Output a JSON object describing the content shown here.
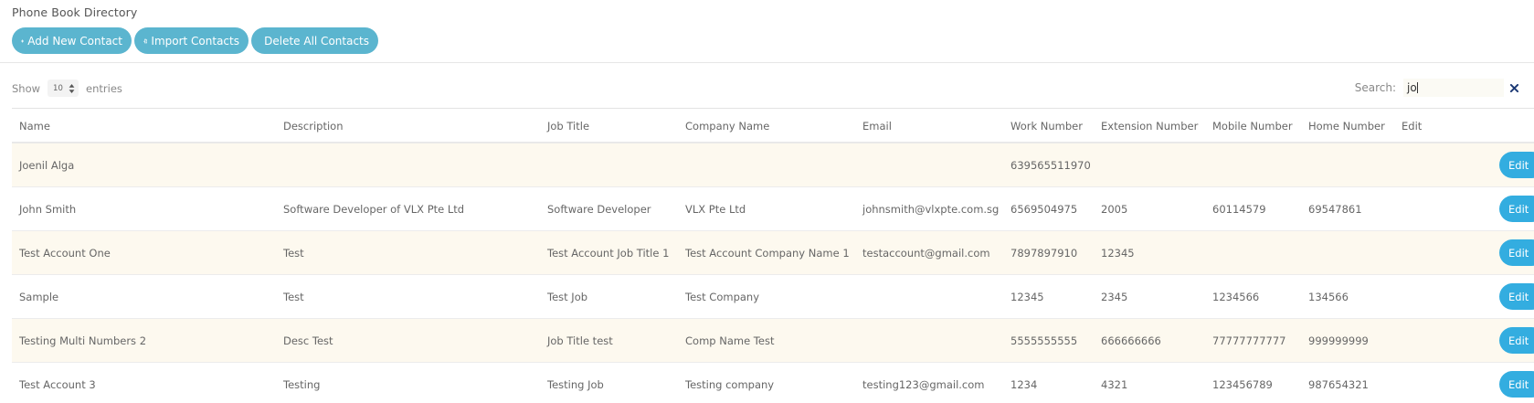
{
  "page": {
    "title": "Phone Book Directory"
  },
  "actions": [
    {
      "label": "Add New Contact",
      "icon": "plus-icon"
    },
    {
      "label": "Import Contacts",
      "icon": "file-import-icon"
    },
    {
      "label": "Delete All Contacts",
      "icon": "trash-icon"
    }
  ],
  "length_control": {
    "show_label": "Show",
    "value": "10",
    "entries_label": "entries"
  },
  "search": {
    "label": "Search:",
    "value": "jo"
  },
  "table": {
    "columns": [
      "Name",
      "Description",
      "Job Title",
      "Company Name",
      "Email",
      "Work Number",
      "Extension Number",
      "Mobile Number",
      "Home Number",
      "Edit"
    ],
    "edit_label": "Edit",
    "rows": [
      [
        "Joenil Alga",
        "",
        "",
        "",
        "",
        "639565511970",
        "",
        "",
        ""
      ],
      [
        "John Smith",
        "Software Developer of VLX Pte Ltd",
        "Software Developer",
        "VLX Pte Ltd",
        "johnsmith@vlxpte.com.sg",
        "6569504975",
        "2005",
        "60114579",
        "69547861"
      ],
      [
        "Test Account One",
        "Test",
        "Test Account Job Title 1",
        "Test Account Company Name 1",
        "testaccount@gmail.com",
        "7897897910",
        "12345",
        "",
        ""
      ],
      [
        "Sample",
        "Test",
        "Test Job",
        "Test Company",
        "",
        "12345",
        "2345",
        "1234566",
        "134566"
      ],
      [
        "Testing Multi Numbers 2",
        "Desc Test",
        "Job Title test",
        "Comp Name Test",
        "",
        "5555555555",
        "666666666",
        "77777777777",
        "999999999"
      ],
      [
        "Test Account 3",
        "Testing",
        "Testing Job",
        "Testing company",
        "testing123@gmail.com",
        "1234",
        "4321",
        "123456789",
        "987654321"
      ]
    ]
  },
  "colors": {
    "action_button": "#5bb5cf",
    "edit_button": "#33ade0",
    "striped_row": "#fdf9ef"
  }
}
